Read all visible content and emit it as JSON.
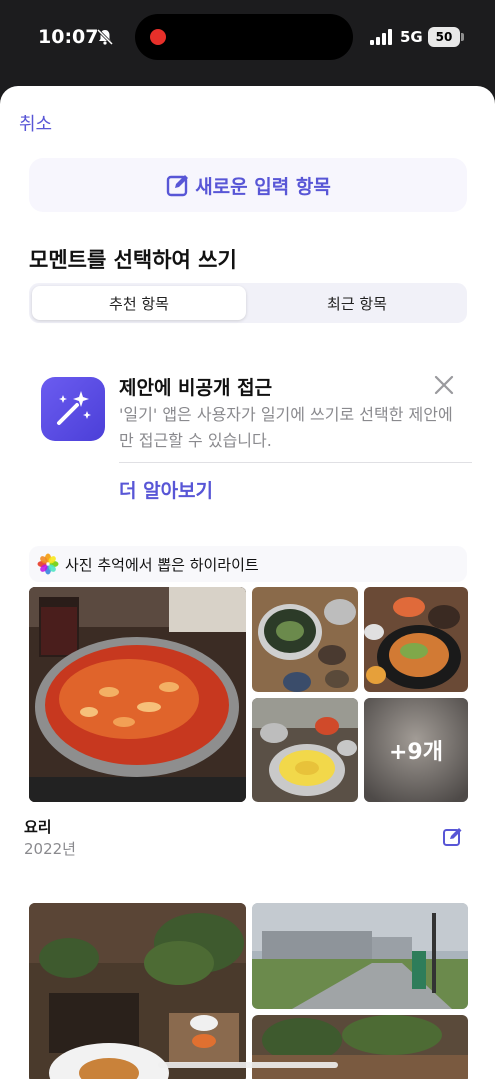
{
  "status": {
    "time": "10:07",
    "network": "5G",
    "battery": "50"
  },
  "header": {
    "cancel": "취소",
    "new_entry": "새로운 입력 항목"
  },
  "section": {
    "title": "모멘트를 선택하여 쓰기"
  },
  "tabs": [
    {
      "label": "추천 항목",
      "selected": true
    },
    {
      "label": "최근 항목",
      "selected": false
    }
  ],
  "privacy": {
    "title": "제안에 비공개 접근",
    "description": "'일기' 앱은 사용자가 일기에 쓰기로 선택한 제안에만 접근할 수 있습니다.",
    "learn_more": "더 알아보기"
  },
  "highlights": {
    "label": "사진 추억에서 뽑은 하이라이트"
  },
  "memory": {
    "title": "요리",
    "year": "2022년",
    "more_label": "+9개"
  },
  "colors": {
    "accent": "#5856d6"
  },
  "icons": [
    "bell-slash-icon",
    "signal-icon",
    "compose-icon",
    "sparkles-magic-icon",
    "close-icon",
    "photos-app-icon",
    "edit-icon"
  ]
}
